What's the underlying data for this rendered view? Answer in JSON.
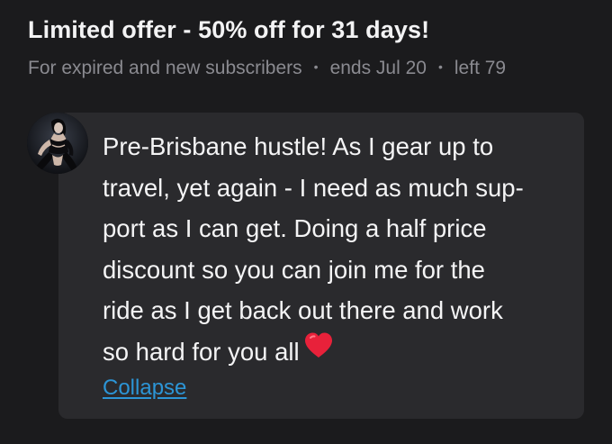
{
  "offer": {
    "title": "Limited offer - 50% off for 31 days!",
    "audience": "For expired and new subscribers",
    "ends": "ends Jul 20",
    "left": "left 79",
    "separator": "•"
  },
  "message": {
    "lines": [
      "Pre-Brisbane hustle! As I gear up to",
      "travel, yet again - I need as much sup-",
      "port as I can get. Doing a half price",
      "discount so you can join me for the",
      "ride as I get back out there and work",
      "so hard for you all"
    ],
    "emoji": "heart-icon",
    "collapse_label": "Collapse"
  },
  "colors": {
    "background": "#1b1b1d",
    "card": "#2a2a2d",
    "muted_text": "#8a8a90",
    "link": "#2c95d6",
    "heart": "#e8213a"
  }
}
